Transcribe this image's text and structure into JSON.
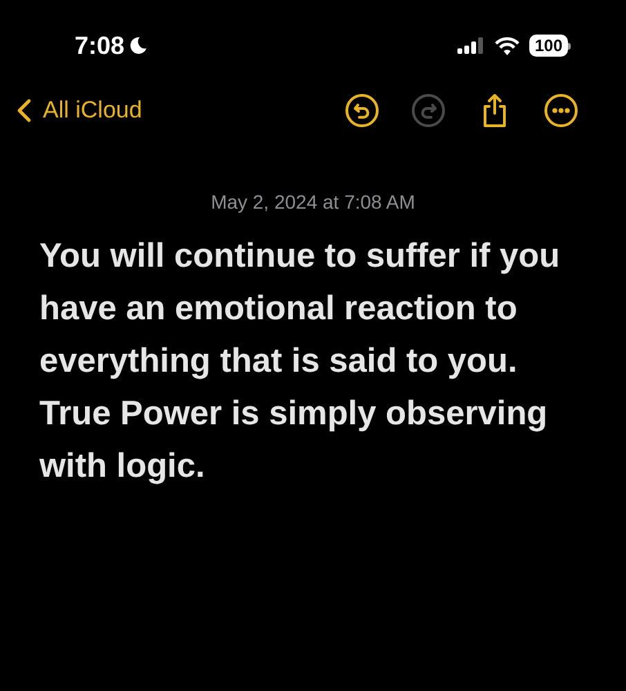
{
  "status_bar": {
    "time": "7:08",
    "battery": "100"
  },
  "nav": {
    "back_label": "All iCloud",
    "tools": [
      {
        "kind": "undo",
        "disabled": false
      },
      {
        "kind": "redo",
        "disabled": true
      },
      {
        "kind": "share",
        "disabled": false
      },
      {
        "kind": "more",
        "disabled": false
      }
    ]
  },
  "note": {
    "date": "May 2, 2024 at 7:08 AM",
    "body": "You will continue to suffer if you have an emotional reaction to everything that is said to you. True Power is simply observing with logic."
  }
}
